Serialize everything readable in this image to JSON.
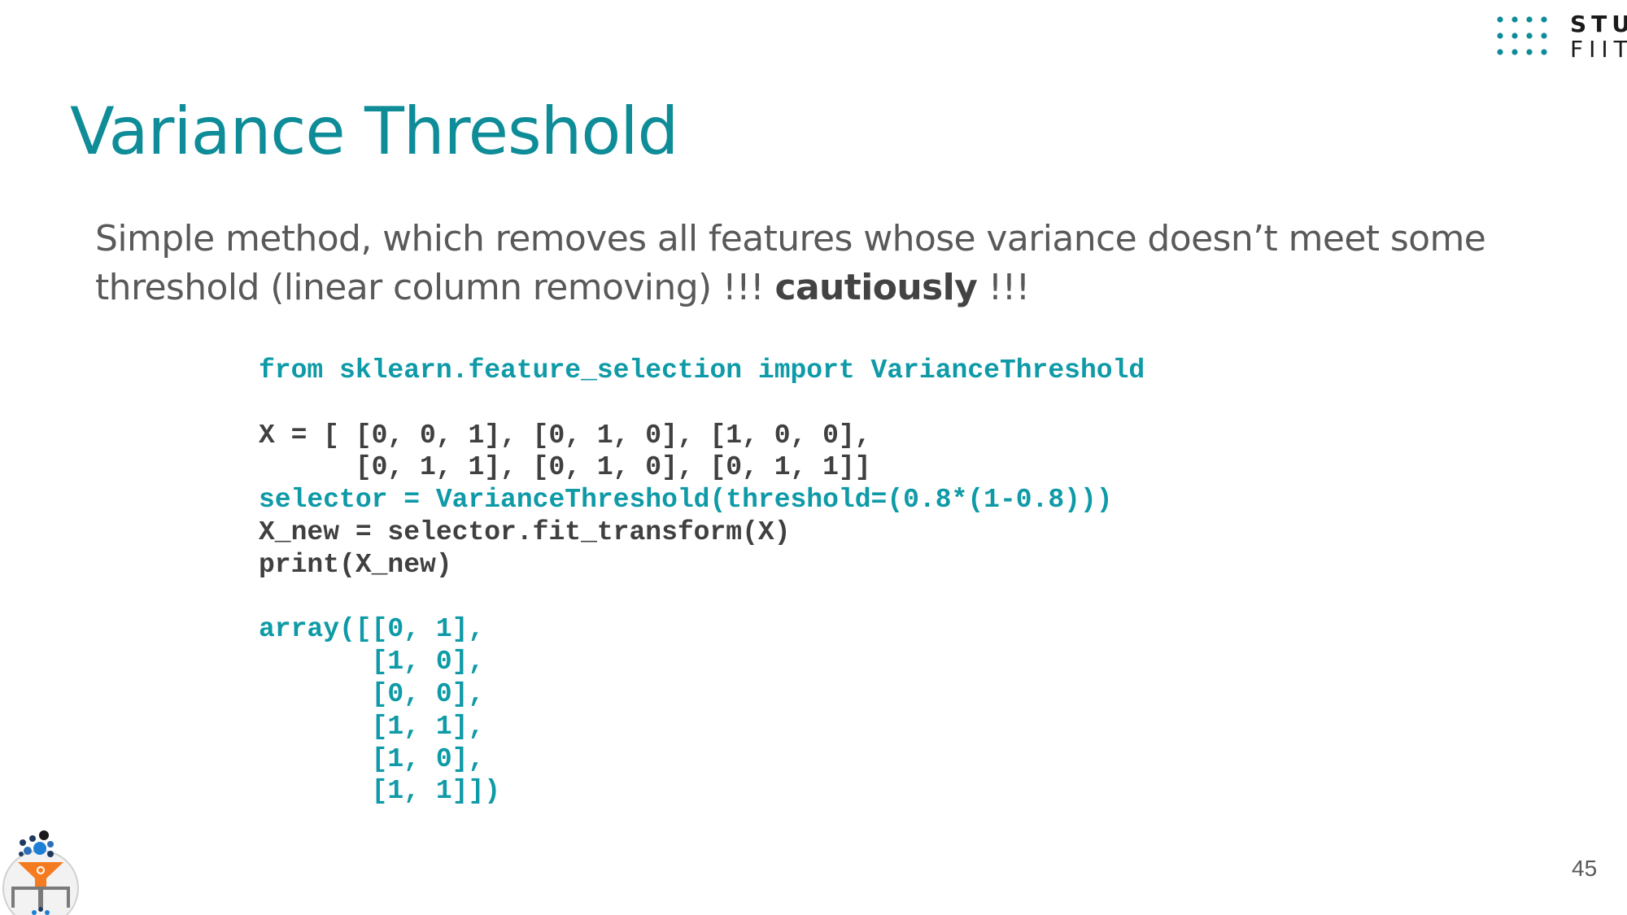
{
  "header": {
    "logo": {
      "line1": "STU",
      "line2": "FIIT",
      "icon": "dot-grid-icon"
    }
  },
  "slide": {
    "title": "Variance Threshold",
    "intro": {
      "text": "Simple method, which removes all features whose variance doesn’t meet some threshold (linear column removing) !!! ",
      "emphasis": "cautiously",
      "suffix": " !!!"
    },
    "code_lines": [
      {
        "text": "from sklearn.feature_selection import VarianceThreshold",
        "style": "teal"
      },
      {
        "text": "",
        "style": "dark"
      },
      {
        "text": "X = [ [0, 0, 1], [0, 1, 0], [1, 0, 0],",
        "style": "dark"
      },
      {
        "text": "      [0, 1, 1], [0, 1, 0], [0, 1, 1]]",
        "style": "dark"
      },
      {
        "text": "selector = VarianceThreshold(threshold=(0.8*(1-0.8)))",
        "style": "teal"
      },
      {
        "text": "X_new = selector.fit_transform(X)",
        "style": "dark"
      },
      {
        "text": "print(X_new)",
        "style": "dark"
      },
      {
        "text": "",
        "style": "dark"
      },
      {
        "text": "array([[0, 1],",
        "style": "teal"
      },
      {
        "text": "       [1, 0],",
        "style": "teal"
      },
      {
        "text": "       [0, 0],",
        "style": "teal"
      },
      {
        "text": "       [1, 1],",
        "style": "teal"
      },
      {
        "text": "       [1, 0],",
        "style": "teal"
      },
      {
        "text": "       [1, 1]])",
        "style": "teal"
      }
    ],
    "page_number": "45"
  },
  "footer": {
    "icon": "feature-selection-funnel-icon"
  },
  "colors": {
    "accent": "#0e8c97",
    "code_accent": "#0e9aa7",
    "code_dark": "#404040",
    "body_text": "#595959",
    "funnel": "#f47b20"
  }
}
